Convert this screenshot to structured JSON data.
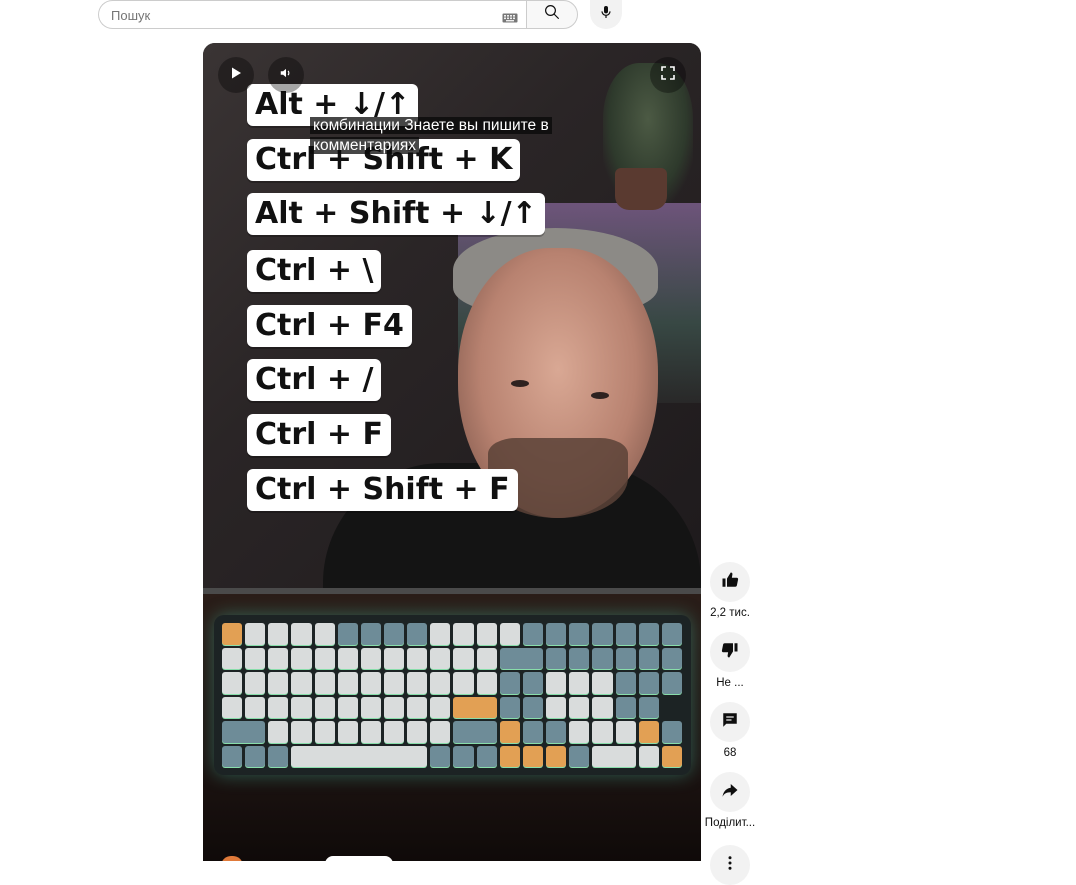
{
  "search": {
    "placeholder": "Пошук"
  },
  "icons": {
    "keyboard": "keyboard-icon",
    "search": "search-icon",
    "mic": "mic-icon",
    "play": "play-icon",
    "volume": "volume-icon",
    "fullscreen": "fullscreen-icon",
    "like": "thumb-up-icon",
    "dislike": "thumb-down-icon",
    "comments": "comment-icon",
    "share": "share-icon",
    "more": "more-vertical-icon"
  },
  "video": {
    "caption_line1": "комбинации Знаете вы пишите в",
    "caption_line2": "комментариях",
    "shortcuts": [
      "Alt + ↓/↑",
      "Ctrl + Shift + K",
      "Alt + Shift + ↓/↑",
      "Ctrl + \\",
      "Ctrl + F4",
      "Ctrl + /",
      "Ctrl + F",
      "Ctrl + Shift + F"
    ]
  },
  "actions": {
    "like_count": "2,2 тис.",
    "dislike_label": "Не ...",
    "comments_count": "68",
    "share_label": "Поділит..."
  },
  "colors": {
    "action_bg": "#f2f2f2",
    "keyboard_glow": "#50e6c8"
  }
}
